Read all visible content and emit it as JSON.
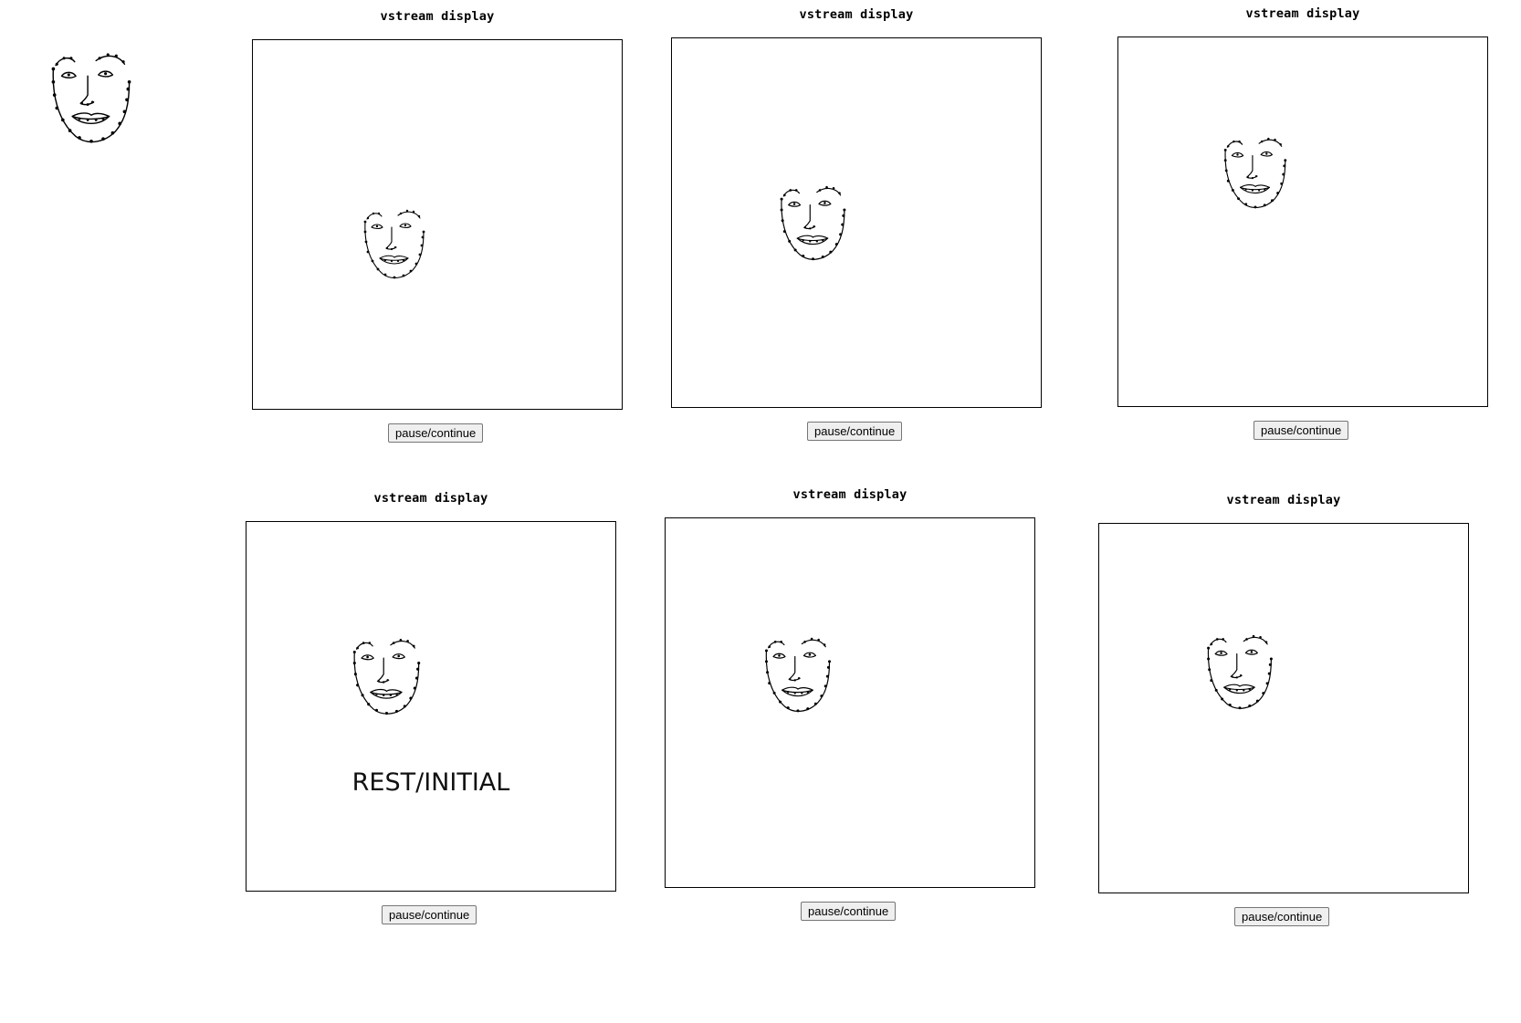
{
  "panels": [
    {
      "title": "vstream display",
      "button_label": "pause/continue",
      "overlay": ""
    },
    {
      "title": "vstream display",
      "button_label": "pause/continue",
      "overlay": ""
    },
    {
      "title": "vstream display",
      "button_label": "pause/continue",
      "overlay": ""
    },
    {
      "title": "vstream display",
      "button_label": "pause/continue",
      "overlay": "REST/INITIAL"
    },
    {
      "title": "vstream display",
      "button_label": "pause/continue",
      "overlay": ""
    },
    {
      "title": "vstream display",
      "button_label": "pause/continue",
      "overlay": ""
    }
  ],
  "icons": {
    "thumbnail": "face-landmarks-icon",
    "display_content": "face-landmarks-icon"
  },
  "colors": {
    "line": "#000000",
    "background": "#ffffff",
    "button_bg": "#efefef"
  }
}
